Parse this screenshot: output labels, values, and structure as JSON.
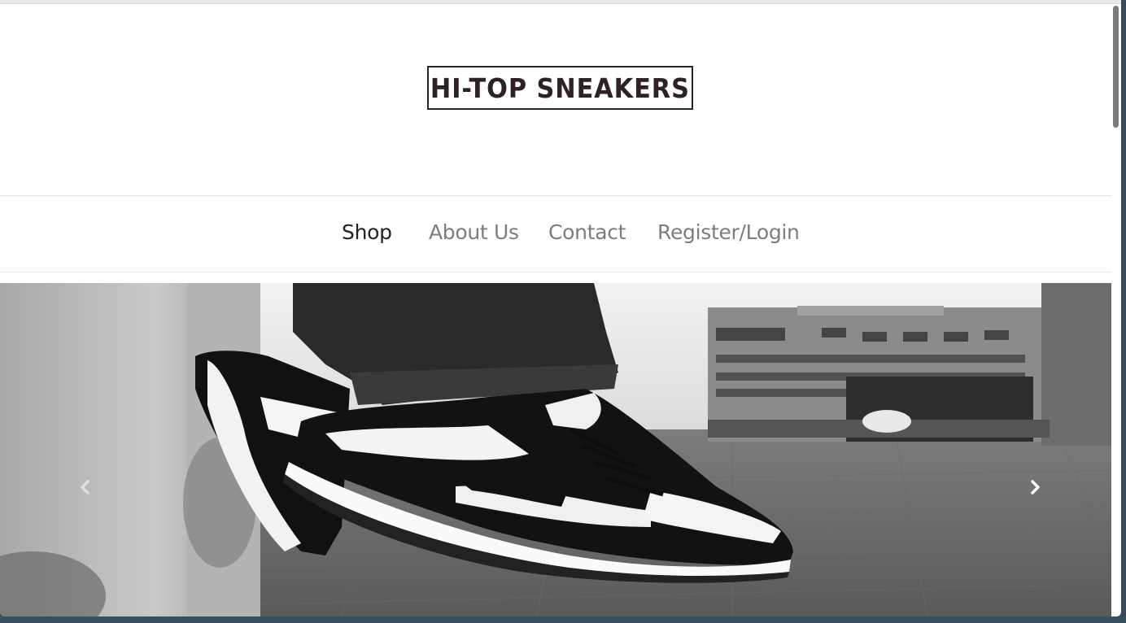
{
  "brand": {
    "logo_text": "HI-TOP SNEAKERS"
  },
  "nav": {
    "items": [
      {
        "label": "Shop",
        "active": true
      },
      {
        "label": "About Us",
        "active": false
      },
      {
        "label": "Contact",
        "active": false
      },
      {
        "label": "Register/Login",
        "active": false
      }
    ]
  },
  "carousel": {
    "prev_icon": "chevron-left-icon",
    "next_icon": "chevron-right-icon",
    "image_icon": "sneaker-photo"
  },
  "colors": {
    "logo": "#2e2226",
    "nav_active": "#222222",
    "nav_inactive": "#7d7d7d"
  }
}
